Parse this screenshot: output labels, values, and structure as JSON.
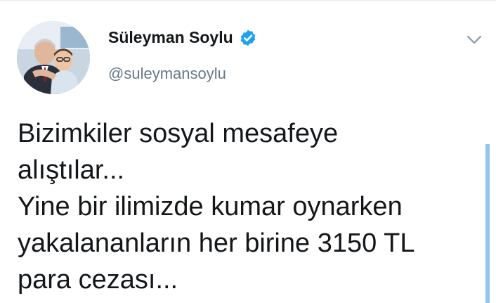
{
  "author": {
    "name": "Süleyman Soylu",
    "handle": "@suleymansoylu",
    "verified": true
  },
  "tweet": {
    "lines": [
      "Bizimkiler sosyal mesafeye",
      "alıştılar...",
      "Yine bir ilimizde kumar oynarken",
      "yakalananların her birine 3150 TL",
      "para cezası..."
    ]
  },
  "icons": {
    "verified": "verified-badge-icon",
    "menu": "chevron-down-icon"
  },
  "colors": {
    "accent": "#1da1f2",
    "text": "#14171a",
    "secondary": "#657786",
    "scrollbar": "#8fc6ee"
  }
}
